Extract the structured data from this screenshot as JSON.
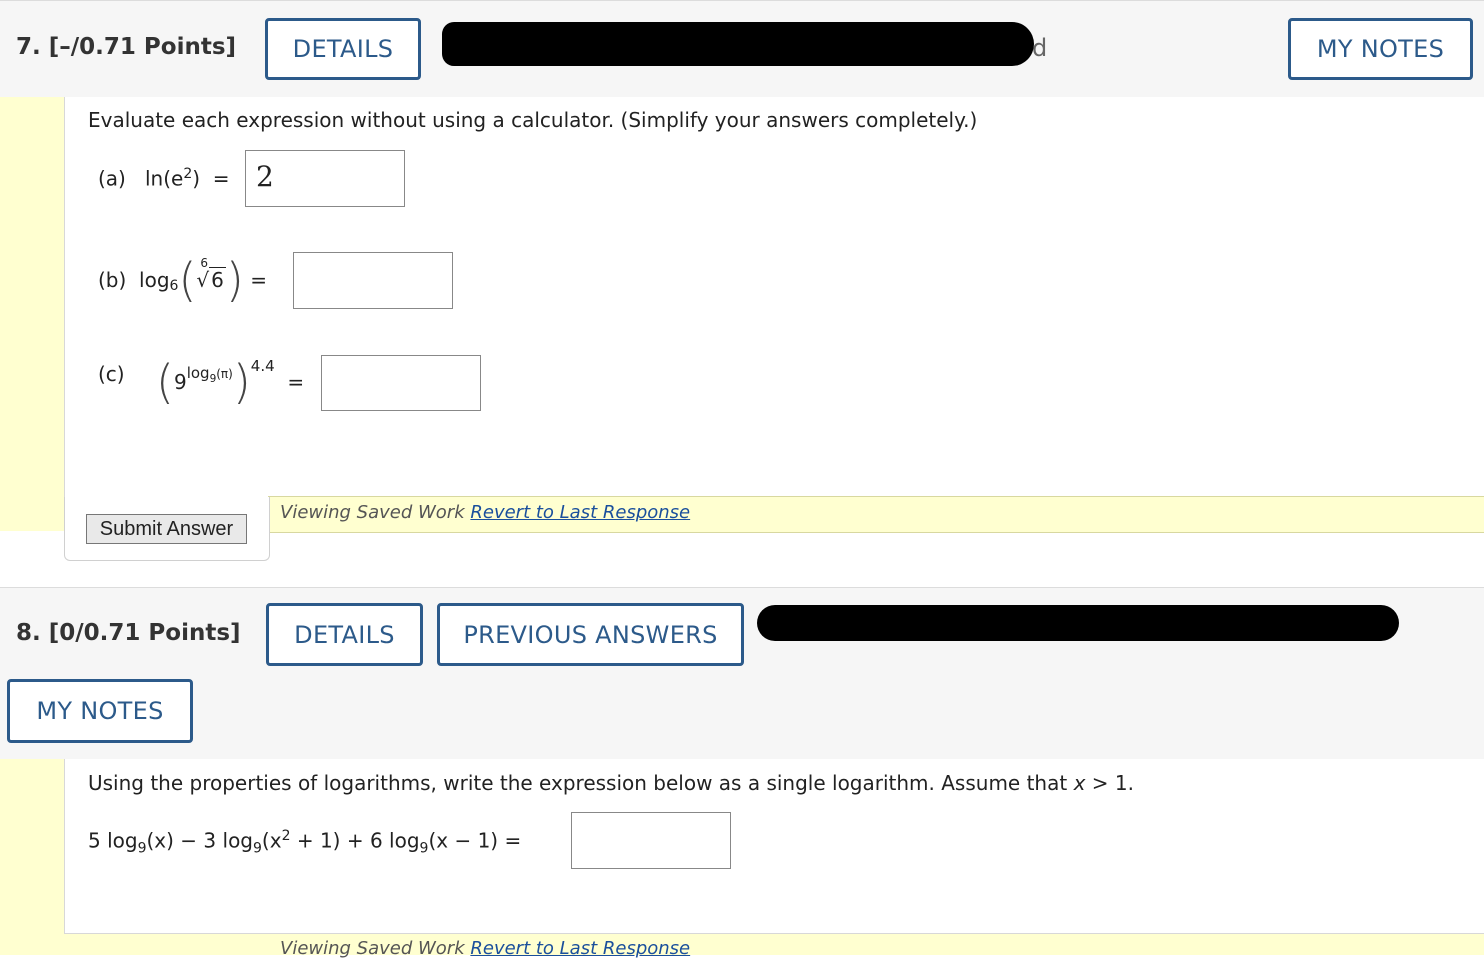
{
  "q7": {
    "title": "7.  [–/0.71 Points]",
    "details_label": "DETAILS",
    "header_visible_text": "d",
    "my_notes_label": "MY NOTES",
    "instructions": "Evaluate each expression without using a calculator. (Simplify your answers completely.)",
    "part_a": {
      "label": "(a)",
      "func": "ln",
      "arg_base": "e",
      "arg_exp": "2",
      "equals": "=",
      "answer": "2"
    },
    "part_b": {
      "label": "(b)",
      "func": "log",
      "base": "6",
      "root_index": "6",
      "radicand": "6",
      "equals": "=",
      "answer": ""
    },
    "part_c": {
      "label": "(c)",
      "base": "9",
      "func": "log",
      "log_base": "9",
      "log_arg": "(π)",
      "outer_exp": "4.4",
      "equals": "=",
      "answer": ""
    },
    "submit_label": "Submit Answer",
    "viewing_text": "Viewing Saved Work",
    "revert_link": "Revert to Last Response"
  },
  "q8": {
    "title": "8.  [0/0.71 Points]",
    "details_label": "DETAILS",
    "previous_answers_label": "PREVIOUS ANSWERS",
    "my_notes_label": "MY NOTES",
    "instructions_pre": "Using the properties of logarithms, write the expression below as a single logarithm. Assume that ",
    "instructions_var": "x",
    "instructions_post": " > 1.",
    "expr": {
      "t1_coef": "5 log",
      "t1_base": "9",
      "t1_arg": "(x)",
      "op1": " − 3 log",
      "t2_base": "9",
      "t2_arg_a": "(x",
      "t2_exp": "2",
      "t2_arg_b": " + 1)",
      "op2": " + 6 log",
      "t3_base": "9",
      "t3_arg": "(x − 1)",
      "equals": " ="
    },
    "answer": "",
    "viewing_text": "Viewing Saved Work",
    "revert_link": "Revert to Last Response"
  },
  "colors": {
    "accent": "#2c5a8a",
    "highlight": "#ffffd0",
    "link": "#1a4f9c"
  }
}
